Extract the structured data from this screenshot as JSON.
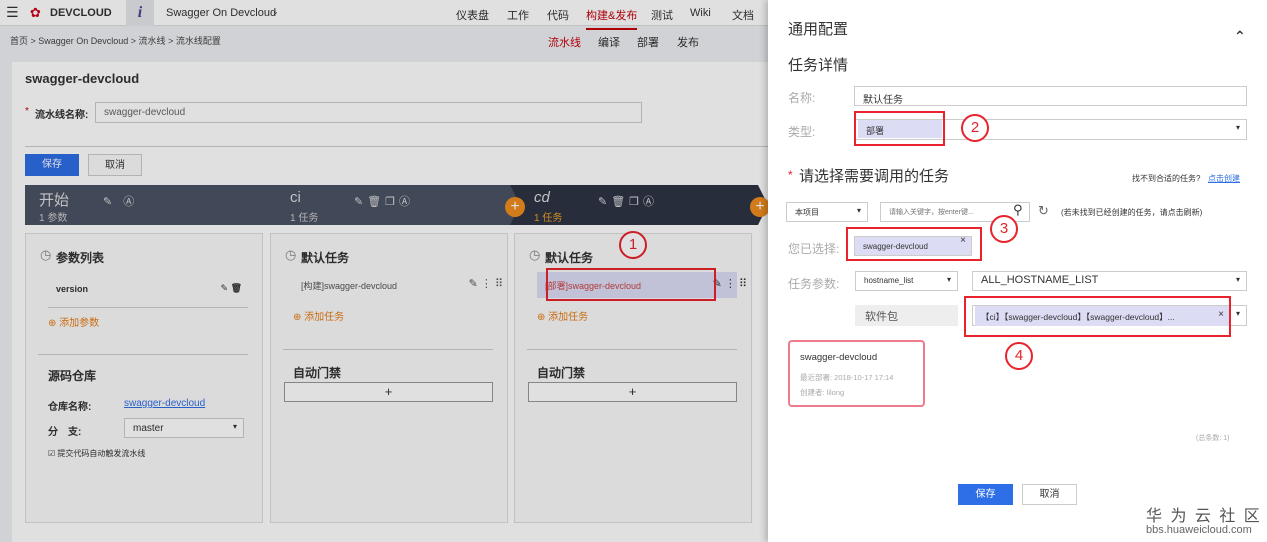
{
  "topbar": {
    "brand": "DEVCLOUD",
    "project": "Swagger On Devcloud",
    "nav": [
      "仪表盘",
      "工作",
      "代码",
      "构建&发布",
      "测试",
      "Wiki",
      "文档"
    ],
    "active_nav": "构建&发布"
  },
  "breadcrumb": "首页 > Swagger On Devcloud > 流水线 > 流水线配置",
  "subnav": [
    "流水线",
    "编译",
    "部署",
    "发布"
  ],
  "pipeline": {
    "title": "swagger-devcloud",
    "name_label": "流水线名称:",
    "name_value": "swagger-devcloud",
    "save": "保存",
    "cancel": "取消",
    "stages": [
      {
        "name": "开始",
        "sub": "1 参数"
      },
      {
        "name": "ci",
        "sub": "1 任务"
      },
      {
        "name": "cd",
        "sub": "1 任务"
      }
    ],
    "columns": [
      {
        "header": "参数列表",
        "task": "version",
        "add": "添加参数"
      },
      {
        "header": "默认任务",
        "task": "[构建]swagger-devcloud",
        "add": "添加任务",
        "gate": "自动门禁"
      },
      {
        "header": "默认任务",
        "task": "[部署]swagger-devcloud",
        "add": "添加任务",
        "gate": "自动门禁"
      }
    ],
    "repo": {
      "title": "源码仓库",
      "repo_label": "仓库名称:",
      "repo_value": "swagger-devcloud",
      "branch_label": "分　支:",
      "branch_value": "master",
      "trigger": "提交代码自动触发流水线"
    },
    "gate_add": "+"
  },
  "panel": {
    "header": "通用配置",
    "section": "任务详情",
    "name_label": "名称:",
    "name_value": "默认任务",
    "type_label": "类型:",
    "type_value": "部署",
    "choose_title": "请选择需要调用的任务",
    "not_found": "找不到合适的任务?",
    "create_link": "点击创建",
    "scope": "本项目",
    "search_placeholder": "请输入关键字，按enter键...",
    "refresh_hint": "(若未找到已经创建的任务，请点击刷新)",
    "selected_label": "您已选择:",
    "selected_value": "swagger-devcloud",
    "params_label": "任务参数:",
    "param_key": "hostname_list",
    "param_value": "ALL_HOSTNAME_LIST",
    "pkg_label": "软件包",
    "pkg_value": "【ci】【swagger-devcloud】【swagger-devcloud】...",
    "result": {
      "name": "swagger-devcloud",
      "deploy": "最近部署: 2018-10-17 17:14",
      "creator": "创建者: lilong"
    },
    "total": "(总条数: 1)",
    "save": "保存",
    "cancel": "取消"
  },
  "annotations": [
    "1",
    "2",
    "3",
    "4"
  ],
  "watermark": {
    "cn": "华 为 云 社 区",
    "url": "bbs.huaweicloud.com"
  }
}
